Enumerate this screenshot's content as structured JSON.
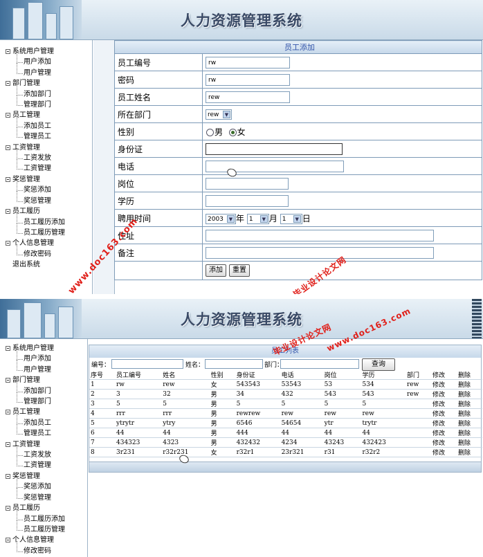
{
  "app_title": "人力资源管理系统",
  "watermark_url": "www.doc163.com",
  "watermark_name": "毕业设计论文网",
  "menu": [
    {
      "label": "系统用户管理",
      "items": [
        "用户添加",
        "用户管理"
      ]
    },
    {
      "label": "部门管理",
      "items": [
        "添加部门",
        "管理部门"
      ]
    },
    {
      "label": "员工管理",
      "items": [
        "添加员工",
        "管理员工"
      ]
    },
    {
      "label": "工资管理",
      "items": [
        "工资发放",
        "工资管理"
      ]
    },
    {
      "label": "奖惩管理",
      "items": [
        "奖惩添加",
        "奖惩管理"
      ]
    },
    {
      "label": "员工履历",
      "items": [
        "员工履历添加",
        "员工履历管理"
      ]
    },
    {
      "label": "个人信息管理",
      "items": [
        "修改密码"
      ]
    }
  ],
  "menu_exit": "退出系统",
  "add_form": {
    "header": "员工添加",
    "fields": {
      "emp_no": {
        "label": "员工编号",
        "value": "rw"
      },
      "password": {
        "label": "密码",
        "value": "rw"
      },
      "name": {
        "label": "员工姓名",
        "value": "rew"
      },
      "dept": {
        "label": "所在部门",
        "value": "rew"
      },
      "gender": {
        "label": "性别",
        "male": "男",
        "female": "女",
        "selected": "女"
      },
      "id_card": {
        "label": "身份证",
        "value": ""
      },
      "phone": {
        "label": "电话",
        "value": ""
      },
      "post": {
        "label": "岗位",
        "value": ""
      },
      "education": {
        "label": "学历",
        "value": ""
      },
      "hire_date": {
        "label": "聘用时间",
        "year": "2003",
        "year_unit": "年",
        "month": "1",
        "month_unit": "月",
        "day": "1",
        "day_unit": "日"
      },
      "address": {
        "label": "住址",
        "value": ""
      },
      "remark": {
        "label": "备注",
        "value": ""
      }
    },
    "submit_label": "添加",
    "reset_label": "重置"
  },
  "list_view": {
    "header": "员工列表",
    "search": {
      "no_label": "编号：",
      "name_label": "姓名：",
      "dept_label": "部门：",
      "button": "查询"
    },
    "columns": [
      "序号",
      "员工编号",
      "姓名",
      "性别",
      "身份证",
      "电话",
      "岗位",
      "学历",
      "部门",
      "修改",
      "删除"
    ],
    "rows": [
      [
        "1",
        "rw",
        "rew",
        "女",
        "543543",
        "53543",
        "53",
        "534",
        "rew",
        "修改",
        "删除"
      ],
      [
        "2",
        "3",
        "32",
        "男",
        "34",
        "432",
        "543",
        "543",
        "rew",
        "修改",
        "删除"
      ],
      [
        "3",
        "5",
        "5",
        "男",
        "5",
        "5",
        "5",
        "5",
        "",
        "修改",
        "删除"
      ],
      [
        "4",
        "rrr",
        "rrr",
        "男",
        "rewrew",
        "rew",
        "rew",
        "rew",
        "",
        "修改",
        "删除"
      ],
      [
        "5",
        "ytrytr",
        "ytry",
        "男",
        "6546",
        "54654",
        "ytr",
        "trytr",
        "",
        "修改",
        "删除"
      ],
      [
        "6",
        "44",
        "44",
        "男",
        "444",
        "44",
        "44",
        "44",
        "",
        "修改",
        "删除"
      ],
      [
        "7",
        "434323",
        "4323",
        "男",
        "432432",
        "4234",
        "43243",
        "432423",
        "",
        "修改",
        "删除"
      ],
      [
        "8",
        "3r231",
        "r32r231",
        "女",
        "r32r1",
        "23r321",
        "r31",
        "r32r2",
        "",
        "修改",
        "删除"
      ]
    ]
  }
}
